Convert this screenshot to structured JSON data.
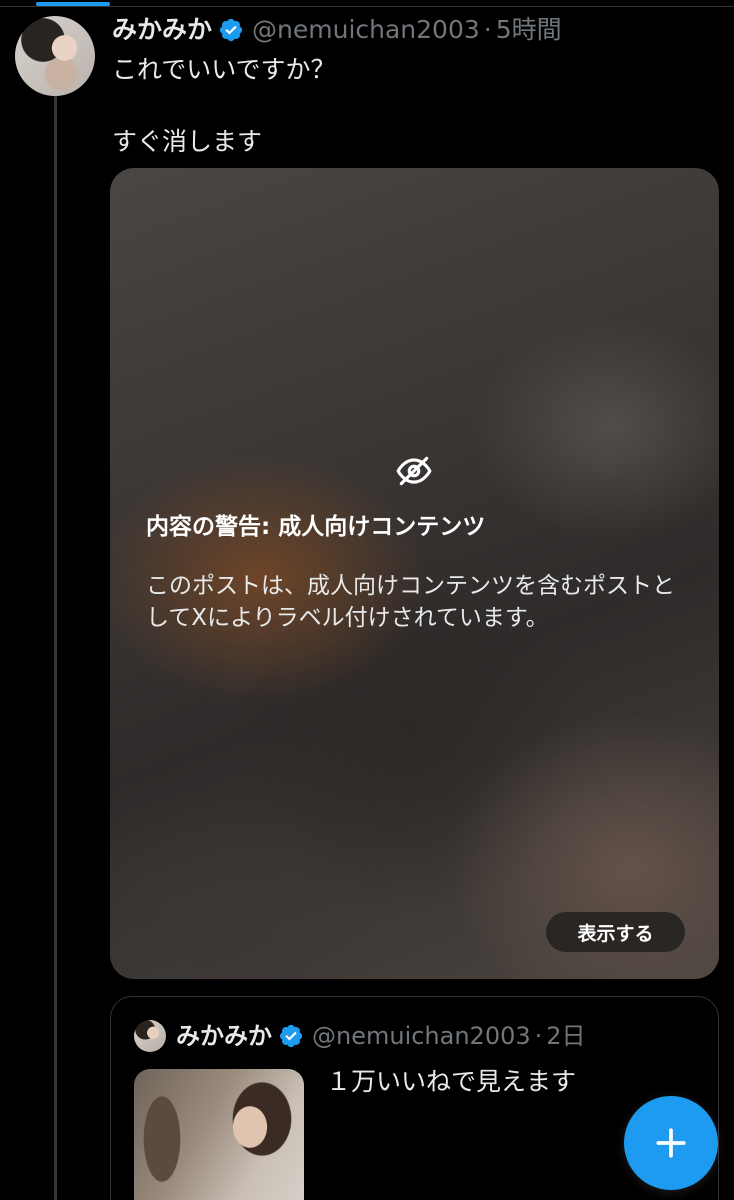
{
  "tweet": {
    "display_name": "みかみか",
    "handle": "@nemuichan2003",
    "separator": "·",
    "time": "5時間",
    "text_line1": "これでいいですか？",
    "text_line2": "すぐ消します"
  },
  "media_warning": {
    "icon": "eye-off-icon",
    "title": "内容の警告: 成人向けコンテンツ",
    "body": "このポストは、成人向けコンテンツを含むポストとしてXによりラベル付けされています。",
    "show_button": "表示する"
  },
  "quote": {
    "display_name": "みかみか",
    "handle": "@nemuichan2003",
    "separator": "·",
    "time": "2日",
    "text": "１万いいねで見えます"
  },
  "fab": {
    "icon": "plus-icon"
  },
  "colors": {
    "accent": "#1d9bf0",
    "background": "#000000",
    "text_primary": "#e7e9ea",
    "text_secondary": "#71767b"
  }
}
